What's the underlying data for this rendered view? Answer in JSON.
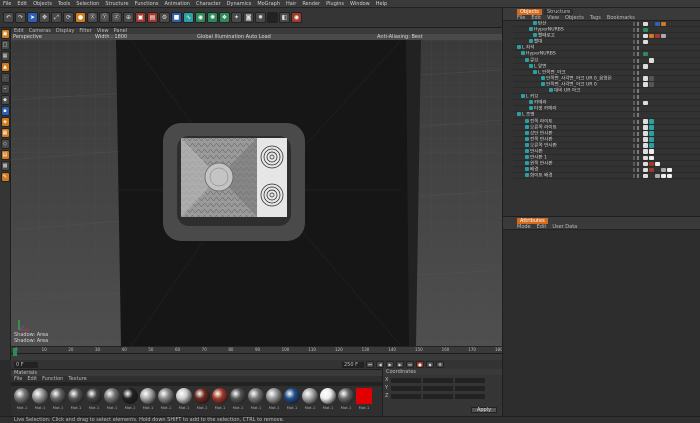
{
  "menubar": [
    "File",
    "Edit",
    "Objects",
    "Tools",
    "Selection",
    "Structure",
    "Functions",
    "Animation",
    "Character",
    "Dynamics",
    "MoGraph",
    "Hair",
    "Render",
    "Plugins",
    "Window",
    "Help"
  ],
  "viewport": {
    "menu": [
      "Edit",
      "Cameras",
      "Display",
      "Filter",
      "View",
      "Panel"
    ],
    "name": "Perspective",
    "width_label": "Width : 1800",
    "render_mode": "Global Illumination Auto Load",
    "aa_mode": "Anti-Aliasing: Best",
    "shadow1": "Shadow: Area",
    "shadow2": "Shadow: Area"
  },
  "timeline": {
    "ticks": [
      "0",
      "10",
      "20",
      "30",
      "40",
      "50",
      "60",
      "70",
      "80",
      "90",
      "100",
      "110",
      "120",
      "130",
      "140",
      "150",
      "160",
      "170",
      "180"
    ],
    "start_frame": "0 F",
    "end_frame": "250 F",
    "current": "0 F"
  },
  "materials": {
    "title": "Materials",
    "menu": [
      "File",
      "Edit",
      "Function",
      "Texture"
    ],
    "items": [
      {
        "label": "Mat.1",
        "color": "#777"
      },
      {
        "label": "Mat.1",
        "color": "#999"
      },
      {
        "label": "Mat.1",
        "color": "#666"
      },
      {
        "label": "Mat.1",
        "color": "#555"
      },
      {
        "label": "Mat.1",
        "color": "#444"
      },
      {
        "label": "Mat.1",
        "color": "#777"
      },
      {
        "label": "Mat.1",
        "color": "#222"
      },
      {
        "label": "Mat.1",
        "color": "#aaa"
      },
      {
        "label": "Mat.1",
        "color": "#888"
      },
      {
        "label": "Mat.1",
        "color": "#ccc"
      },
      {
        "label": "Mat.1",
        "color": "#6a2a1f"
      },
      {
        "label": "Mat.1",
        "color": "#a03a2a"
      },
      {
        "label": "Mat.1",
        "color": "#555"
      },
      {
        "label": "Mat.1",
        "color": "#777"
      },
      {
        "label": "Mat.1",
        "color": "#999"
      },
      {
        "label": "Mat.1",
        "color": "#1f4f8a"
      },
      {
        "label": "Mat.1",
        "color": "#aaa"
      },
      {
        "label": "Mat.1",
        "color": "#eee"
      },
      {
        "label": "Mat.1",
        "color": "#666"
      },
      {
        "label": "Mat.1",
        "color": "#e00000"
      }
    ]
  },
  "coordinates": {
    "title": "Coordinates",
    "apply": "Apply",
    "fields": [
      "X",
      "Y",
      "Z"
    ]
  },
  "objects": {
    "tabs": [
      "Objects",
      "Structure"
    ],
    "menu": [
      "File",
      "Edit",
      "View",
      "Objects",
      "Tags",
      "Bookmarks"
    ],
    "rows": [
      {
        "name": "탄산",
        "indent": 20,
        "tags": [
          "#ddd",
          "#333",
          "#2d5fb3",
          "#d07a1c"
        ]
      },
      {
        "name": "HyperNURBS",
        "indent": 16,
        "tags": [
          "#2e8a58"
        ]
      },
      {
        "name": "빨때로고",
        "indent": 20,
        "tags": [
          "#ddd",
          "#d07a1c",
          "#a13a2c",
          "#aaa"
        ]
      },
      {
        "name": "빨대",
        "indent": 16,
        "tags": [
          "#ddd"
        ]
      },
      {
        "name": "L 자석",
        "indent": 4,
        "tags": []
      },
      {
        "name": "HyperNURBS",
        "indent": 8,
        "tags": [
          "#2e8a58"
        ]
      },
      {
        "name": "큐브",
        "indent": 12,
        "tags": [
          "#333",
          "#ddd"
        ]
      },
      {
        "name": "L 앞면",
        "indent": 16,
        "tags": [
          "#ddd",
          "#333"
        ]
      },
      {
        "name": "L 안쪽면_아크",
        "indent": 20,
        "tags": []
      },
      {
        "name": "안쪽면_사각면_아크 UR 0_음영된",
        "indent": 28,
        "tags": [
          "#ddd",
          "#555"
        ]
      },
      {
        "name": "안쪽면_사각면_아크 UR 0",
        "indent": 28,
        "tags": [
          "#ddd",
          "#555"
        ]
      },
      {
        "name": "대비 UR 아크",
        "indent": 36,
        "tags": []
      },
      {
        "name": "L 커브",
        "indent": 8,
        "tags": []
      },
      {
        "name": "카메라",
        "indent": 16,
        "tags": [
          "#ddd"
        ]
      },
      {
        "name": "타겟 카메라",
        "indent": 16,
        "tags": []
      },
      {
        "name": "L 조명",
        "indent": 4,
        "tags": []
      },
      {
        "name": "전쪽 라이트",
        "indent": 12,
        "tags": [
          "#ddd",
          "#2c9fa3"
        ]
      },
      {
        "name": "오른쪽 라이트",
        "indent": 12,
        "tags": [
          "#ddd",
          "#2c9fa3"
        ]
      },
      {
        "name": "상단 반사판",
        "indent": 12,
        "tags": [
          "#ddd",
          "#2c9fa3"
        ]
      },
      {
        "name": "전쪽 반사판",
        "indent": 12,
        "tags": [
          "#ddd",
          "#2c9fa3"
        ]
      },
      {
        "name": "오른쪽 반사판",
        "indent": 12,
        "tags": [
          "#ddd",
          "#2c9fa3"
        ]
      },
      {
        "name": "반사판",
        "indent": 12,
        "tags": [
          "#ddd",
          "#eee"
        ]
      },
      {
        "name": "반사판 1",
        "indent": 12,
        "tags": [
          "#ddd",
          "#eee"
        ]
      },
      {
        "name": "윈쪽 반사판",
        "indent": 12,
        "tags": [
          "#ddd",
          "#a13a2c",
          "#eee"
        ]
      },
      {
        "name": "배경",
        "indent": 12,
        "tags": [
          "#ddd",
          "#a13a2c",
          "#333",
          "#aaa",
          "#eee"
        ]
      },
      {
        "name": "화이트 배경",
        "indent": 12,
        "tags": [
          "#ddd",
          "#333",
          "#aaa",
          "#eee",
          "#eee"
        ]
      }
    ]
  },
  "attributes": {
    "tab": "Attributes",
    "menu": [
      "Mode",
      "Edit",
      "User Data"
    ]
  },
  "status": "Live Selection: Click and drag to select elements. Hold down SHIFT to add to the selection, CTRL to remove.",
  "colors": {
    "accent": "#d46b1b",
    "frame_dark": "#2e2e2e",
    "frame_mid": "#4a4a4a",
    "red_material": "#e00000"
  }
}
